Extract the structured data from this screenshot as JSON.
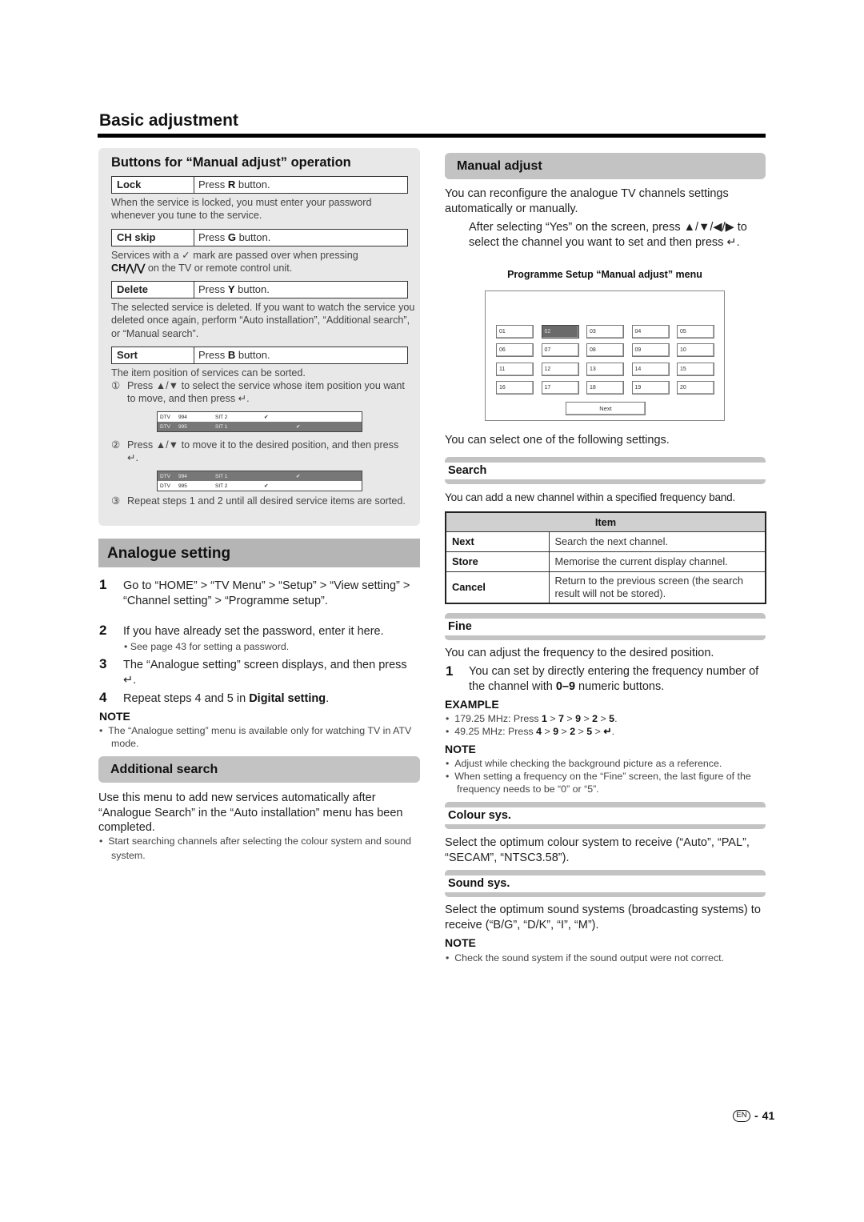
{
  "page": {
    "title": "Basic adjustment",
    "language_badge": "EN",
    "page_number": "41",
    "page_separator": "-"
  },
  "buttons_panel": {
    "title": "Buttons for “Manual adjust” operation",
    "rows": [
      {
        "key": "Lock",
        "press": "Press ",
        "button": "R",
        "suffix": " button.",
        "desc": "When the service is locked, you must enter your password whenever you tune to the service."
      },
      {
        "key": "CH skip",
        "press": "Press ",
        "button": "G",
        "suffix": " button.",
        "desc_a": "Services with a ✓ mark are passed over when pressing",
        "desc_b_bold": "CH⋀/⋁",
        "desc_b": " on the TV or remote control unit."
      },
      {
        "key": "Delete",
        "press": "Press ",
        "button": "Y",
        "suffix": " button.",
        "desc": "The selected service is deleted. If you want to watch the service you deleted once again, perform “Auto installation”, “Additional search”, or “Manual search”."
      },
      {
        "key": "Sort",
        "press": "Press ",
        "button": "B",
        "suffix": " button.",
        "desc": "The item position of services can be sorted."
      }
    ],
    "sort_steps": [
      {
        "marker": "①",
        "text": "Press ▲/▼ to select the service whose item position you want to move, and then press ↵."
      },
      {
        "marker": "②",
        "text": "Press ▲/▼ to move it to the desired position, and then press ↵."
      },
      {
        "marker": "③",
        "text": "Repeat steps 1 and 2 until all desired service items are sorted."
      }
    ],
    "sort_list_before": [
      {
        "type": "DTV",
        "num": "994",
        "name": "SIT 2",
        "check": "✔",
        "selected": false
      },
      {
        "type": "DTV",
        "num": "995",
        "name": "SIT 1",
        "check": "✔",
        "selected": true
      }
    ],
    "sort_list_after": [
      {
        "type": "DTV",
        "num": "994",
        "name": "SIT 1",
        "check": "✔",
        "selected": true
      },
      {
        "type": "DTV",
        "num": "995",
        "name": "SIT 2",
        "check": "✔",
        "selected": false
      }
    ]
  },
  "analogue_setting": {
    "title": "Analogue setting",
    "steps": [
      {
        "num": "1",
        "text": "Go to “HOME” > “TV Menu” > “Setup” > “View setting” > “Channel setting” > “Programme setup”."
      },
      {
        "num": "2",
        "text": "If you have already set the password, enter it here.",
        "bullet": "See page 43 for setting a password."
      },
      {
        "num": "3",
        "text": "The “Analogue setting” screen displays, and then press ↵."
      },
      {
        "num": "4",
        "text_a": "Repeat steps 4 and 5 in ",
        "text_bold": "Digital setting",
        "text_b": "."
      }
    ],
    "note_heading": "NOTE",
    "note": "The “Analogue setting” menu is available only for watching TV in ATV mode."
  },
  "additional_search": {
    "title": "Additional search",
    "body": "Use this menu to add new services automatically after “Analogue Search” in the “Auto installation” menu has been completed.",
    "bullet": "Start searching channels after selecting the colour system and sound system."
  },
  "manual_adjust": {
    "title": "Manual adjust",
    "intro": "You can reconfigure the analogue TV channels settings automatically or manually.",
    "instruction": "After selecting “Yes” on the screen, press ▲/▼/◀/▶ to select the channel you want to set and then press ↵.",
    "menu_caption": "Programme Setup “Manual adjust” menu",
    "channels": [
      "01",
      "02",
      "03",
      "04",
      "05",
      "06",
      "07",
      "08",
      "09",
      "10",
      "11",
      "12",
      "13",
      "14",
      "15",
      "16",
      "17",
      "18",
      "19",
      "20"
    ],
    "selected_channel": "02",
    "next_label": "Next",
    "select_text": "You can select one of the following settings."
  },
  "search": {
    "title": "Search",
    "body": "You can add a new channel within a specified frequency band.",
    "table_header": "Item",
    "rows": [
      {
        "item": "Next",
        "desc": "Search the next channel."
      },
      {
        "item": "Store",
        "desc": "Memorise the current display channel."
      },
      {
        "item": "Cancel",
        "desc": "Return to the previous screen (the search result will not be stored)."
      }
    ]
  },
  "fine": {
    "title": "Fine",
    "body": "You can adjust the frequency to the desired position.",
    "step_num": "1",
    "step_a": "You can set by directly entering the frequency number of the channel with ",
    "step_bold": "0–9",
    "step_b": " numeric buttons.",
    "example_heading": "EXAMPLE",
    "examples": [
      {
        "label": "179.25 MHz: Press ",
        "keys": [
          "1",
          "7",
          "9",
          "2",
          "5"
        ],
        "end": "."
      },
      {
        "label": "49.25 MHz: Press ",
        "keys": [
          "4",
          "9",
          "2",
          "5",
          "↵"
        ],
        "end": "."
      }
    ],
    "note_heading": "NOTE",
    "notes": [
      "Adjust while checking the background picture as a reference.",
      "When setting a frequency on the “Fine” screen, the last figure of the frequency needs to be “0” or “5”."
    ]
  },
  "colour_sys": {
    "title": "Colour sys.",
    "body": "Select the optimum colour system to receive (“Auto”, “PAL”, “SECAM”, “NTSC3.58”)."
  },
  "sound_sys": {
    "title": "Sound sys.",
    "body": "Select the optimum sound systems (broadcasting systems) to receive (“B/G”, “D/K”, “I”, “M”).",
    "note_heading": "NOTE",
    "note": "Check the sound system if the sound output were not correct."
  }
}
